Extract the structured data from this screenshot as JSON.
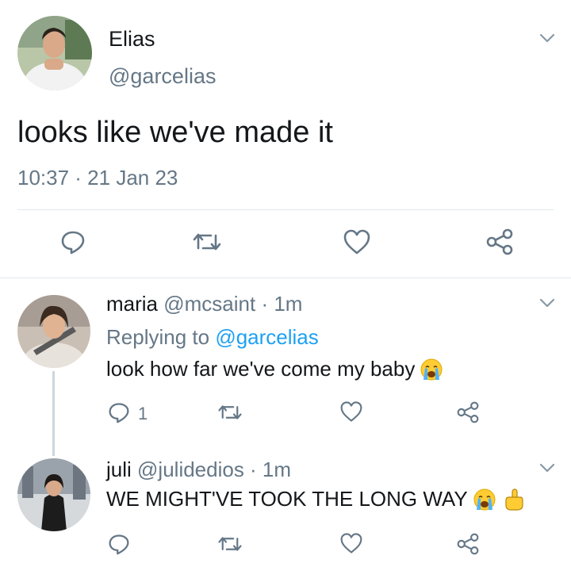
{
  "main_tweet": {
    "name": "Elias",
    "handle": "@garcelias",
    "text": "looks like we've made it",
    "timestamp": "10:37 · 21 Jan 23",
    "actions": [
      "reply-icon",
      "retweet-icon",
      "like-icon",
      "share-icon"
    ]
  },
  "replies": [
    {
      "name": "maria",
      "meta": "@mcsaint · 1m",
      "replying_prefix": "Replying to ",
      "replying_handle": "@garcelias",
      "text": "look how far we've come my baby",
      "emojis": [
        "crying-face-emoji"
      ],
      "reply_count": "1"
    },
    {
      "name": "juli",
      "meta": "@julidedios · 1m",
      "text": "WE MIGHT'VE TOOK THE LONG WAY",
      "emojis": [
        "crying-face-emoji",
        "pointing-up-emoji"
      ]
    }
  ],
  "colors": {
    "text": "#14171a",
    "secondary": "#657786",
    "accent": "#1da1f2",
    "divider": "#e1e8ed"
  }
}
